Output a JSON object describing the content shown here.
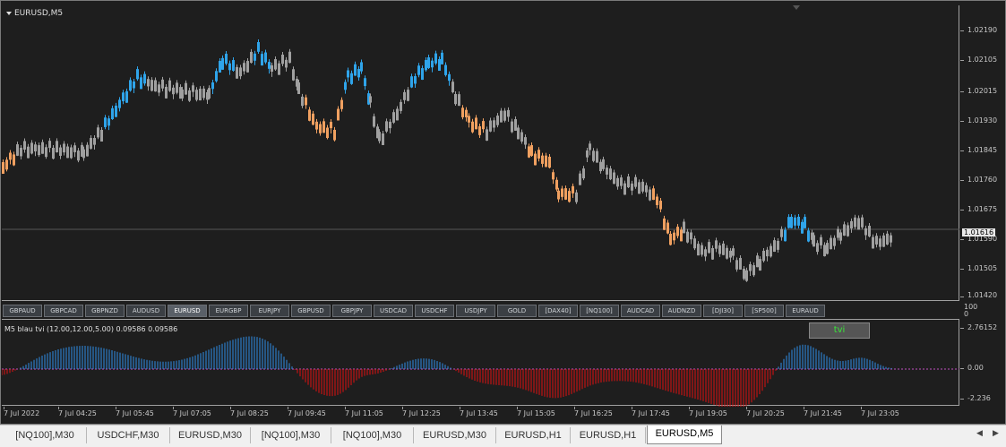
{
  "chart": {
    "symbol": "EURUSD,M5",
    "current_price": "1.01616",
    "price_ticks": [
      "1.02190",
      "1.02105",
      "1.02015",
      "1.01930",
      "1.01845",
      "1.01760",
      "1.01675",
      "1.01590",
      "1.01505",
      "1.01420"
    ],
    "time_ticks": [
      "7 Jul 2022",
      "7 Jul 04:25",
      "7 Jul 05:45",
      "7 Jul 07:05",
      "7 Jul 08:25",
      "7 Jul 09:45",
      "7 Jul 11:05",
      "7 Jul 12:25",
      "7 Jul 13:45",
      "7 Jul 15:05",
      "7 Jul 16:25",
      "7 Jul 17:45",
      "7 Jul 19:05",
      "7 Jul 20:25",
      "7 Jul 21:45",
      "7 Jul 23:05"
    ],
    "colors": {
      "bull": "#2fa4ea",
      "bear": "#f0a060",
      "neutral": "#a0a0a0",
      "background": "#1e1e1e",
      "ind_pos": "#2f8ee8",
      "ind_neg": "#e01010"
    }
  },
  "symbol_buttons": [
    "GBPAUD",
    "GBPCAD",
    "GBPNZD",
    "AUDUSD",
    "EURUSD",
    "EURGBP",
    "EURJPY",
    "GBPUSD",
    "GBPJPY",
    "USDCAD",
    "USDCHF",
    "USDJPY",
    "GOLD",
    "[DAX40]",
    "[NQ100]",
    "AUDCAD",
    "AUDNZD",
    "[DJI30]",
    "[SP500]",
    "EURAUD"
  ],
  "active_symbol": "EURUSD",
  "separator_axis": {
    "top": "100",
    "bottom": "0"
  },
  "indicator": {
    "label": "M5  blau tvi (12.00,12.00,5.00)  0.09586 0.09586",
    "box_text": "tvi",
    "ticks": [
      "2.76152",
      "0.00",
      "-2.236"
    ]
  },
  "tabs": [
    "[NQ100],M30",
    "USDCHF,M30",
    "EURUSD,M30",
    "[NQ100],M30",
    "[NQ100],M30",
    "EURUSD,M30",
    "EURUSD,H1",
    "EURUSD,H1",
    "EURUSD,M5"
  ],
  "active_tab": "EURUSD,M5",
  "tab_controls": {
    "left": "◀",
    "right": "▶"
  }
}
